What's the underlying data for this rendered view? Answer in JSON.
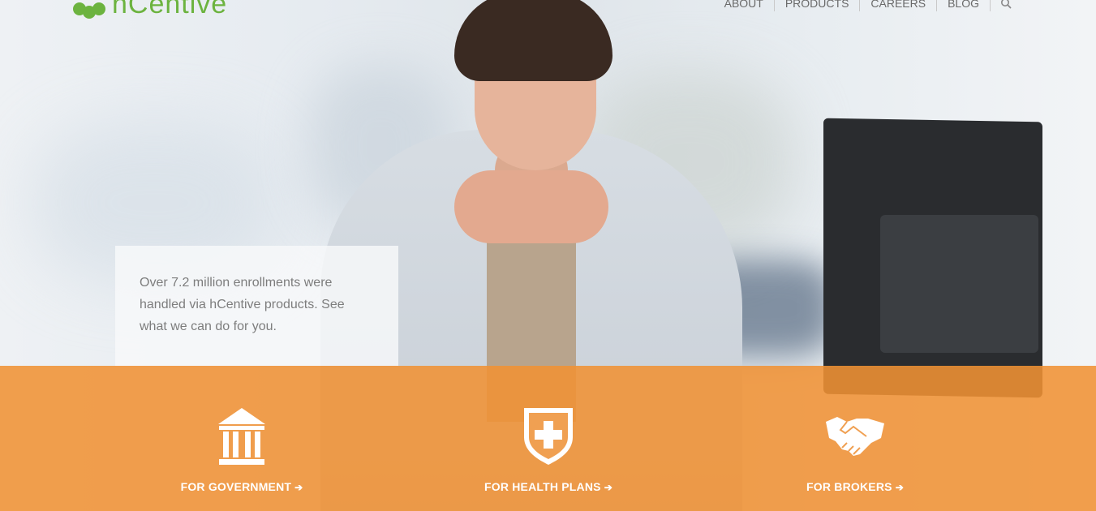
{
  "header": {
    "logo_text": "hCentive",
    "nav": [
      {
        "label": "ABOUT"
      },
      {
        "label": "PRODUCTS"
      },
      {
        "label": "CAREERS"
      },
      {
        "label": "BLOG"
      }
    ],
    "search_icon": "search-icon"
  },
  "hero": {
    "callout_text": "Over 7.2 million enrollments were handled via hCentive products. See what we can do for you."
  },
  "ctas": [
    {
      "label": "FOR GOVERNMENT",
      "arrow": "➔",
      "icon": "government-building-icon"
    },
    {
      "label": "FOR HEALTH PLANS",
      "arrow": "➔",
      "icon": "health-shield-icon"
    },
    {
      "label": "FOR BROKERS",
      "arrow": "➔",
      "icon": "handshake-icon"
    }
  ],
  "colors": {
    "brand_green": "#6cb33f",
    "band_orange": "#f09234",
    "nav_text": "#6a6a6a"
  }
}
